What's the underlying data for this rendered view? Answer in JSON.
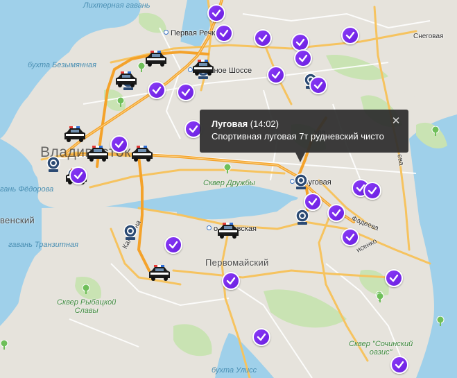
{
  "map": {
    "labels": {
      "bay_lihternaya": "Лихтерная гавань",
      "bay_bezymyannaya": "бухта Безымянная",
      "bay_fedorova": "гань Фёдорова",
      "bay_tranzitnaya": "гавань Транзитная",
      "bay_ulis": "бухта Улисс",
      "district_vensky": "венский",
      "city": "Владивосток",
      "district_pervomaisky": "Первомайский",
      "stop_pervaya_rechka": "Первая Речка",
      "stop_shosse": "о  ренное Шоссе",
      "stop_lugovaya": "о    Луговая",
      "stop_kaltsevskaya": "о  льцевская",
      "street_snegovaya": "Снеговая",
      "street_fadeeva": "Фадеева",
      "street_borisenko": "исенко",
      "street_kalinina": "Калинина",
      "street_rudneva": "ева",
      "street_ruda": "уда",
      "park_druzhby": "Сквер Дружбы",
      "park_rybatskoy_slavy": "Сквер Рыбацкой\nСлавы",
      "park_sochinsky": "Сквер \"Сочинский\nоазис\""
    }
  },
  "popup": {
    "title": "Луговая",
    "time": "(14:02)",
    "text": "Спортивная луговая 7т рудневский чисто",
    "close_glyph": "✕"
  },
  "markers": {
    "checkins": 28,
    "cameras": 8,
    "police": 9,
    "parks": 9
  },
  "colors": {
    "accent_purple": "#7b2ff0",
    "camera_blue": "#2b4a73",
    "water": "#9fd0ea",
    "land": "#e6e3dc",
    "major_road": "#f4a22a",
    "minor_road": "#f6c35f",
    "park": "#c9e3b3",
    "popup_bg": "#2d2d2d"
  }
}
